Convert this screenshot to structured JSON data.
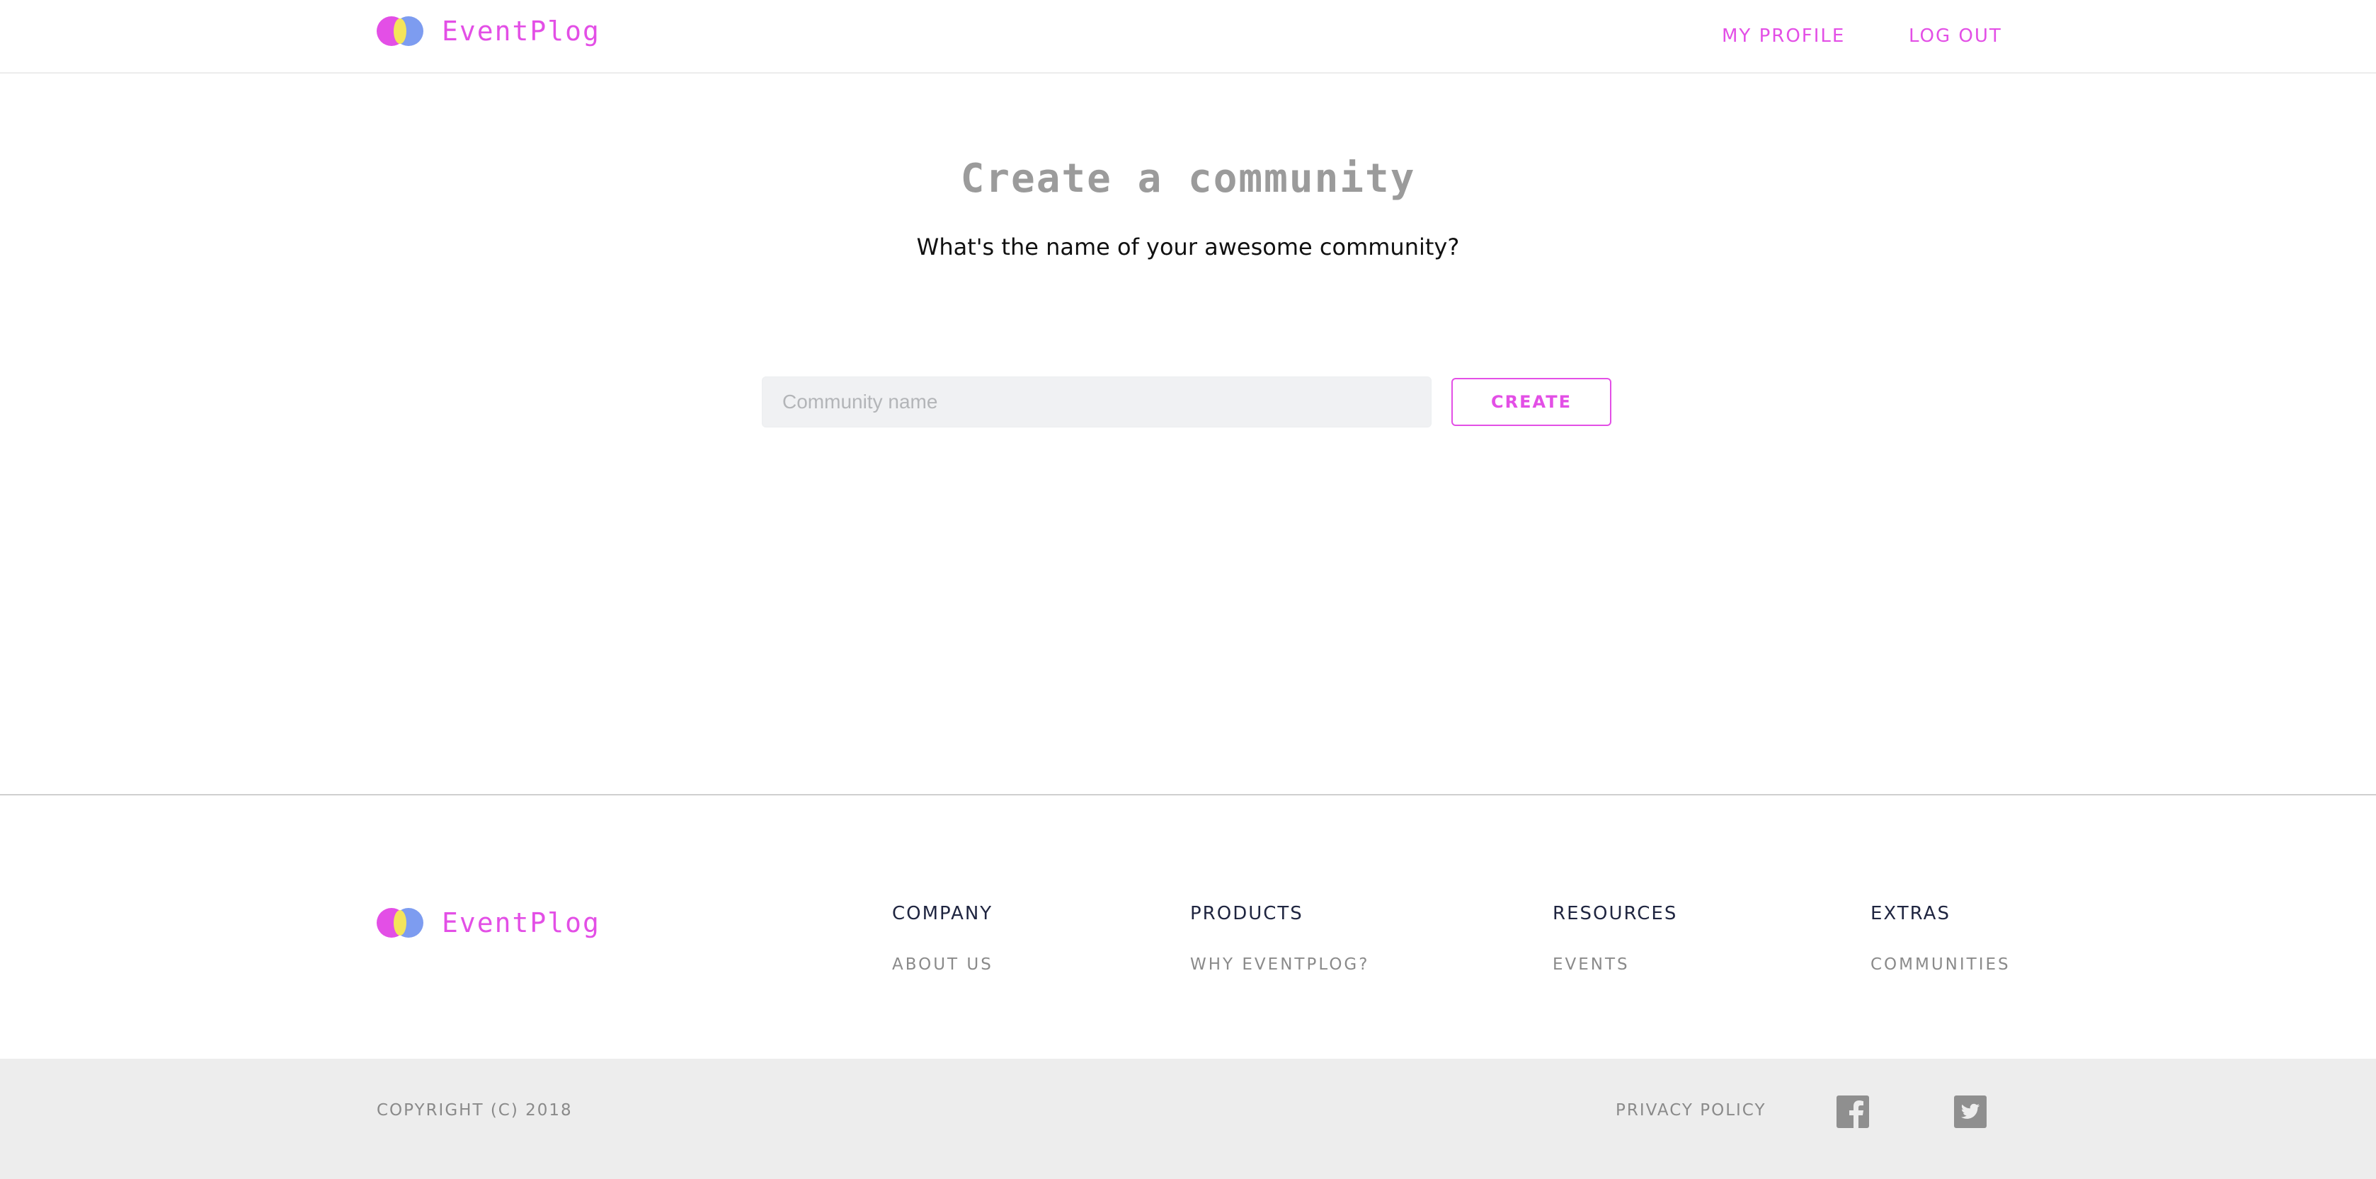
{
  "brand": {
    "name": "EventPlog",
    "colors": {
      "accent": "#e34fe6",
      "logo_left": "#e34fe6",
      "logo_right": "#7d9cf0",
      "logo_overlap": "#f4e45a"
    }
  },
  "header": {
    "nav": {
      "profile": "MY PROFILE",
      "logout": "LOG OUT"
    }
  },
  "main": {
    "title": "Create a community",
    "subtitle": "What's the name of your awesome community?",
    "input": {
      "placeholder": "Community name",
      "value": ""
    },
    "create_label": "CREATE"
  },
  "footer": {
    "columns": [
      {
        "heading": "COMPANY",
        "link": "ABOUT US"
      },
      {
        "heading": "PRODUCTS",
        "link": "WHY EVENTPLOG?"
      },
      {
        "heading": "RESOURCES",
        "link": "EVENTS"
      },
      {
        "heading": "EXTRAS",
        "link": "COMMUNITIES"
      }
    ],
    "copyright": "COPYRIGHT (C) 2018",
    "privacy": "PRIVACY POLICY",
    "social": [
      {
        "icon": "facebook-icon"
      },
      {
        "icon": "twitter-icon"
      }
    ]
  }
}
